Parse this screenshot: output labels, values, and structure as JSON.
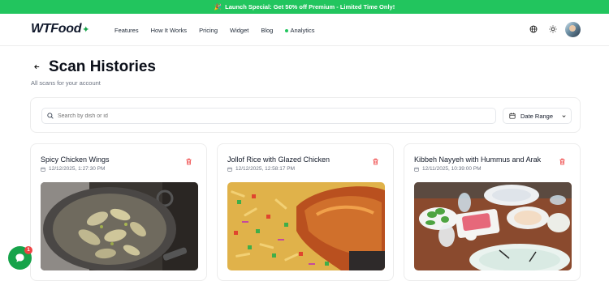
{
  "banner": {
    "emoji": "🎉",
    "text": "Launch Special: Get 50% off Premium - Limited Time Only!"
  },
  "brand": {
    "name": "WTFood",
    "accent": "#22c55e"
  },
  "nav": {
    "links": [
      "Features",
      "How It Works",
      "Pricing",
      "Widget",
      "Blog"
    ],
    "analytics": "Analytics"
  },
  "page": {
    "title": "Scan Histories",
    "subtitle": "All scans for your account"
  },
  "filters": {
    "search_placeholder": "Search by dish or id",
    "date_range_label": "Date Range"
  },
  "scans": [
    {
      "title": "Spicy Chicken Wings",
      "date": "12/12/2025, 1:27:30 PM",
      "photo": "chicken-wings-in-pan"
    },
    {
      "title": "Jollof Rice with Glazed Chicken",
      "date": "12/12/2025, 12:58:17 PM",
      "photo": "jollof-rice-with-chicken"
    },
    {
      "title": "Kibbeh Nayyeh with Hummus and Arak",
      "date": "12/11/2025, 10:39:00 PM",
      "photo": "kibbeh-table-spread"
    }
  ],
  "chat": {
    "badge_count": "1"
  }
}
